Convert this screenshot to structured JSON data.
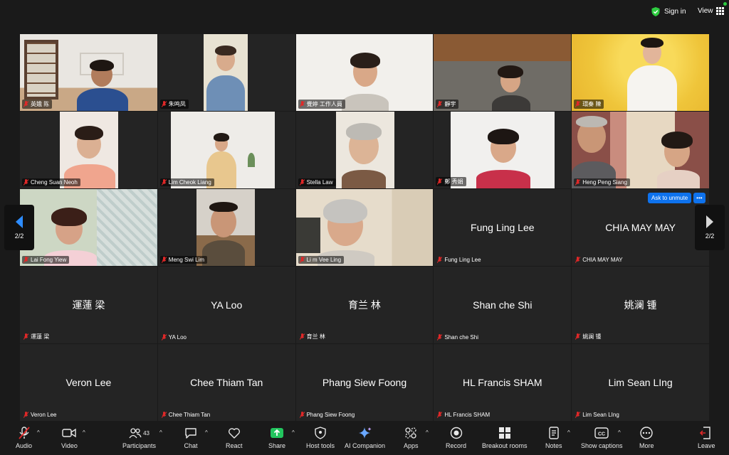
{
  "topbar": {
    "signin_label": "Sign in",
    "view_label": "View",
    "accent_green": "#2ecc40"
  },
  "pagination": {
    "left_label": "2/2",
    "right_label": "2/2",
    "active_color": "#2d8cff"
  },
  "ask_to_unmute": {
    "label": "Ask to unmute",
    "more_label": "•••"
  },
  "participants": [
    {
      "name": "英娥 陈",
      "video": true
    },
    {
      "name": "朱鸣凤",
      "video": true
    },
    {
      "name": "覺婷 工作人員",
      "video": true
    },
    {
      "name": "靜宇",
      "video": true
    },
    {
      "name": "環秦 陳",
      "video": true
    },
    {
      "name": "Cheng Suan Neoh",
      "video": true
    },
    {
      "name": "Lim Cheok Liang",
      "video": true
    },
    {
      "name": "Stella Law",
      "video": true
    },
    {
      "name": "鄭 秀娟",
      "video": true
    },
    {
      "name": "Heng Peng Siang",
      "video": true
    },
    {
      "name": "Lai Fong Yiew",
      "video": true
    },
    {
      "name": "Meng Swi Lim",
      "video": true
    },
    {
      "name": "Li m Vee Ling",
      "video": true
    },
    {
      "name": "Fung Ling Lee",
      "video": false
    },
    {
      "name": "CHIA MAY MAY",
      "video": false
    },
    {
      "name": "運蓮 梁",
      "video": false
    },
    {
      "name": "YA Loo",
      "video": false
    },
    {
      "name": "育兰 林",
      "video": false
    },
    {
      "name": "Shan che Shi",
      "video": false
    },
    {
      "name": "姚澜 锺",
      "video": false
    },
    {
      "name": "Veron Lee",
      "video": false
    },
    {
      "name": "Chee Thiam Tan",
      "video": false
    },
    {
      "name": "Phang Siew Foong",
      "video": false
    },
    {
      "name": "HL Francis SHAM",
      "video": false
    },
    {
      "name": "Lim Sean LIng",
      "video": false
    }
  ],
  "toolbar": {
    "audio": "Audio",
    "video": "Video",
    "participants": "Participants",
    "participants_count": "43",
    "chat": "Chat",
    "react": "React",
    "share": "Share",
    "host_tools": "Host tools",
    "ai_companion": "AI Companion",
    "apps": "Apps",
    "record": "Record",
    "breakout_rooms": "Breakout rooms",
    "notes": "Notes",
    "show_captions": "Show captions",
    "more": "More",
    "leave": "Leave",
    "share_color": "#22c55e",
    "mute_color": "#e02828"
  }
}
